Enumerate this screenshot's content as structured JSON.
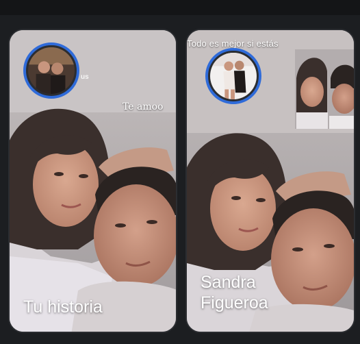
{
  "stories": [
    {
      "name": "Tu historia",
      "overlay_caption": "Te amoo",
      "ring_color": "#2f6bd9"
    },
    {
      "name_line1": "Sandra",
      "name_line2": "Figueroa",
      "overlay_caption": "Todo es mejor si estás",
      "ring_color": "#2f6bd9"
    }
  ],
  "colors": {
    "background": "#1c1e21",
    "card_border": "#2b2d31",
    "story_ring": "#2f6bd9",
    "text": "#ffffff"
  }
}
